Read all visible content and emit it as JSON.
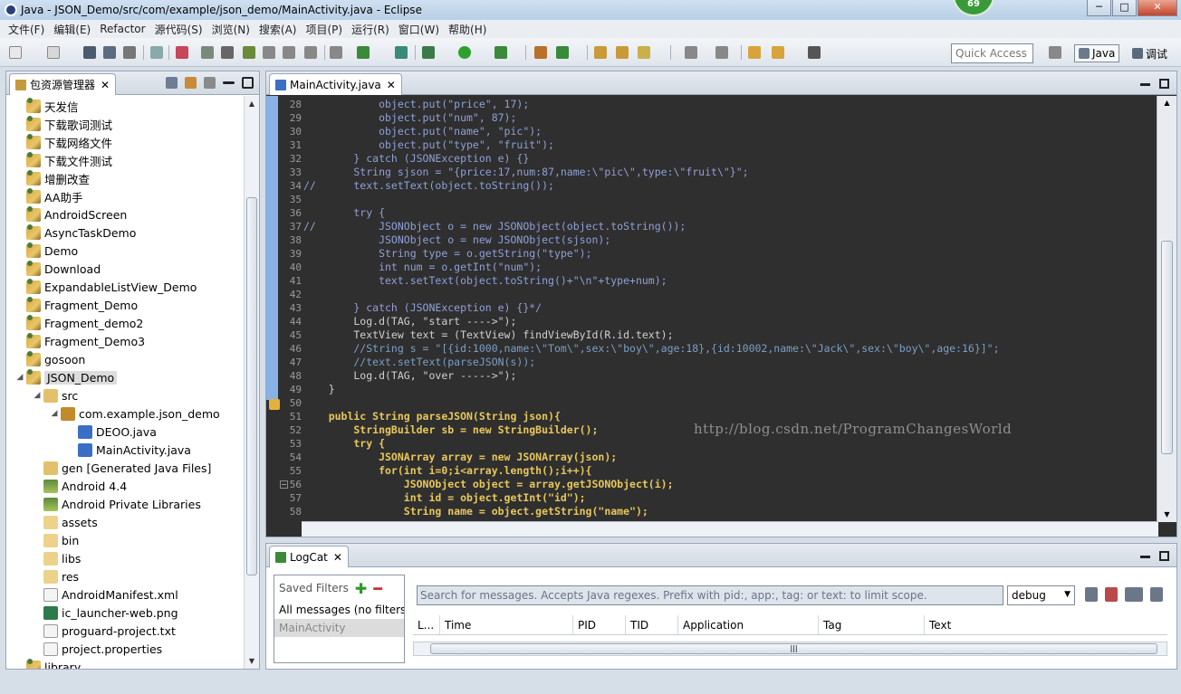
{
  "window": {
    "title": "Java - JSON_Demo/src/com/example/json_demo/MainActivity.java - Eclipse",
    "badge": "69",
    "minimize": "─",
    "maximize": "□",
    "close": "✕"
  },
  "menu": [
    "文件(F)",
    "编辑(E)",
    "Refactor",
    "源代码(S)",
    "浏览(N)",
    "搜索(A)",
    "项目(P)",
    "运行(R)",
    "窗口(W)",
    "帮助(H)"
  ],
  "toolbar": {
    "quick_access": "Quick Access",
    "perspective_java": "Java",
    "perspective_debug": "调试"
  },
  "explorer": {
    "tab": "包资源管理器",
    "close": "✕",
    "items": [
      "天发信",
      "下载歌词测试",
      "下载网络文件",
      "下载文件测试",
      "增删改查",
      "AA助手",
      "AndroidScreen",
      "AsyncTaskDemo",
      "Demo",
      "Download",
      "ExpandableListView_Demo",
      "Fragment_Demo",
      "Fragment_demo2",
      "Fragment_Demo3",
      "gosoon",
      "JSON_Demo",
      "src",
      "com.example.json_demo",
      "DEOO.java",
      "MainActivity.java",
      "gen [Generated Java Files]",
      "Android 4.4",
      "Android Private Libraries",
      "assets",
      "bin",
      "libs",
      "res",
      "AndroidManifest.xml",
      "ic_launcher-web.png",
      "proguard-project.txt",
      "project.properties",
      "library"
    ]
  },
  "editor": {
    "tab": "MainActivity.java",
    "close": "✕",
    "line_numbers": [
      "28",
      "29",
      "30",
      "31",
      "32",
      "33",
      "34",
      "35",
      "36",
      "37",
      "38",
      "39",
      "40",
      "41",
      "42",
      "43",
      "44",
      "45",
      "46",
      "47",
      "48",
      "49",
      "50",
      "51",
      "52",
      "53",
      "54",
      "55",
      "56",
      "57",
      "58"
    ],
    "lines": [
      "            object.put(\"price\", 17);",
      "            object.put(\"num\", 87);",
      "            object.put(\"name\", \"pic\");",
      "            object.put(\"type\", \"fruit\");",
      "        } catch (JSONException e) {}",
      "        String sjson = \"{price:17,num:87,name:\\\"pic\\\",type:\\\"fruit\\\"}\";",
      "//      text.setText(object.toString());",
      "",
      "        try {",
      "//          JSONObject o = new JSONObject(object.toString());",
      "            JSONObject o = new JSONObject(sjson);",
      "            String type = o.getString(\"type\");",
      "            int num = o.getInt(\"num\");",
      "            text.setText(object.toString()+\"\\n\"+type+num);",
      "",
      "        } catch (JSONException e) {}*/",
      "        Log.d(TAG, \"start ---->\");",
      "        TextView text = (TextView) findViewById(R.id.text);",
      "        //String s = \"[{id:1000,name:\\\"Tom\\\",sex:\\\"boy\\\",age:18},{id:10002,name:\\\"Jack\\\",sex:\\\"boy\\\",age:16}]\";",
      "        //text.setText(parseJSON(s));",
      "        Log.d(TAG, \"over ----->\");",
      "    }",
      "",
      "    public String parseJSON(String json){",
      "        StringBuilder sb = new StringBuilder();",
      "        try {",
      "            JSONArray array = new JSONArray(json);",
      "            for(int i=0;i<array.length();i++){",
      "                JSONObject object = array.getJSONObject(i);",
      "                int id = object.getInt(\"id\");",
      "                String name = object.getString(\"name\");"
    ],
    "watermark": "http://blog.csdn.net/ProgramChangesWorld"
  },
  "logcat": {
    "tab": "LogCat",
    "close": "✕",
    "saved_filters": "Saved Filters",
    "add": "✚",
    "remove": "━",
    "filters": [
      "All messages (no filters)",
      "MainActivity"
    ],
    "search_placeholder": "Search for messages. Accepts Java regexes. Prefix with pid:, app:, tag: or text: to limit scope.",
    "level": "debug",
    "columns": [
      "L...",
      "Time",
      "PID",
      "TID",
      "Application",
      "Tag",
      "Text"
    ]
  },
  "colors": {
    "editor_bg": "#2f2f2f",
    "keyword": "#e8c75a",
    "string": "#8fa0d8",
    "comment": "#7a9fc4",
    "ruler": "#88b2e6"
  }
}
